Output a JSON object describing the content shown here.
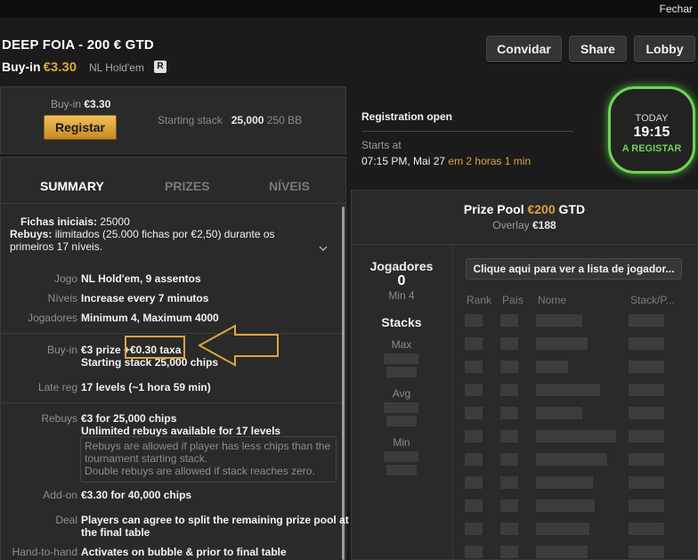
{
  "window": {
    "close_label": "Fechar"
  },
  "header": {
    "title": "DEEP FOIA - 200 € GTD",
    "buyin_label": "Buy-in",
    "buyin_value": "€3.30",
    "game_type": "NL Hold'em",
    "badge": "R",
    "buttons": {
      "invite": "Convidar",
      "share": "Share",
      "lobby": "Lobby"
    }
  },
  "register_panel": {
    "buyin_label": "Buy-in",
    "buyin_value": "€3.30",
    "register_button": "Registar",
    "starting_stack_label": "Starting stack",
    "starting_stack_value": "25,000",
    "starting_stack_bb": "250 BB"
  },
  "registration": {
    "status": "Registration open",
    "starts_at_label": "Starts at",
    "start_time": "07:15 PM, Mai 27",
    "relative_time": "em 2 horas 1 min"
  },
  "today_badge": {
    "label": "TODAY",
    "time": "19:15",
    "status": "A REGISTAR",
    "accent": "#6ed455"
  },
  "tabs": {
    "summary": "SUMMARY",
    "prizes": "PRIZES",
    "levels": "NÍVEIS"
  },
  "summary": {
    "chips_label": "Fichas iniciais:",
    "chips_value": "25000",
    "rebuys_label": "Rebuys:",
    "rebuys_text_1": "ilimitados (25.000 fichas por €2,50) durante os",
    "rebuys_text_2": "primeiros 17 níveis.",
    "rows": {
      "game_label": "Jogo",
      "game_value": "NL Hold'em, 9 assentos",
      "levels_label": "Níveis",
      "levels_value": "Increase every 7 minutos",
      "players_label": "Jogadores",
      "players_value": "Minimum 4, Maximum 4000",
      "buyin_label": "Buy-in",
      "buyin_prize": "€3 prize +",
      "buyin_fee": "€0.30 taxa",
      "buyin_stack": "Starting stack 25,000 chips",
      "latereg_label": "Late reg",
      "latereg_value": "17 levels (~1 hora 59 min)",
      "rebuys_label": "Rebuys",
      "rebuys_value": "€3 for 25,000 chips",
      "rebuys_unlimited": "Unlimited rebuys available for 17 levels",
      "rebuys_note_1": "Rebuys are allowed if player has less chips than the",
      "rebuys_note_2": "tournament starting stack.",
      "rebuys_note_3": "Double rebuys are allowed if stack reaches zero.",
      "addon_label": "Add-on",
      "addon_value": "€3.30 for 40,000 chips",
      "deal_label": "Deal",
      "deal_value_1": "Players can agree to split the remaining prize pool at",
      "deal_value_2": "the final table",
      "h2h_label": "Hand-to-hand",
      "h2h_value": "Activates on bubble & prior to final table"
    }
  },
  "prize_pool": {
    "label": "Prize Pool",
    "amount": "€200",
    "suffix": "GTD",
    "overlay_label": "Overlay",
    "overlay_value": "€188"
  },
  "players": {
    "label": "Jogadores",
    "count": "0",
    "min_label": "Min 4",
    "stacks_label": "Stacks",
    "max_label": "Max",
    "avg_label": "Avg",
    "min_stack_label": "Min"
  },
  "player_list": {
    "button": "Clique aqui para ver a lista de jogador...",
    "columns": [
      "Rank",
      "País",
      "Nome",
      "Stack/P..."
    ]
  }
}
